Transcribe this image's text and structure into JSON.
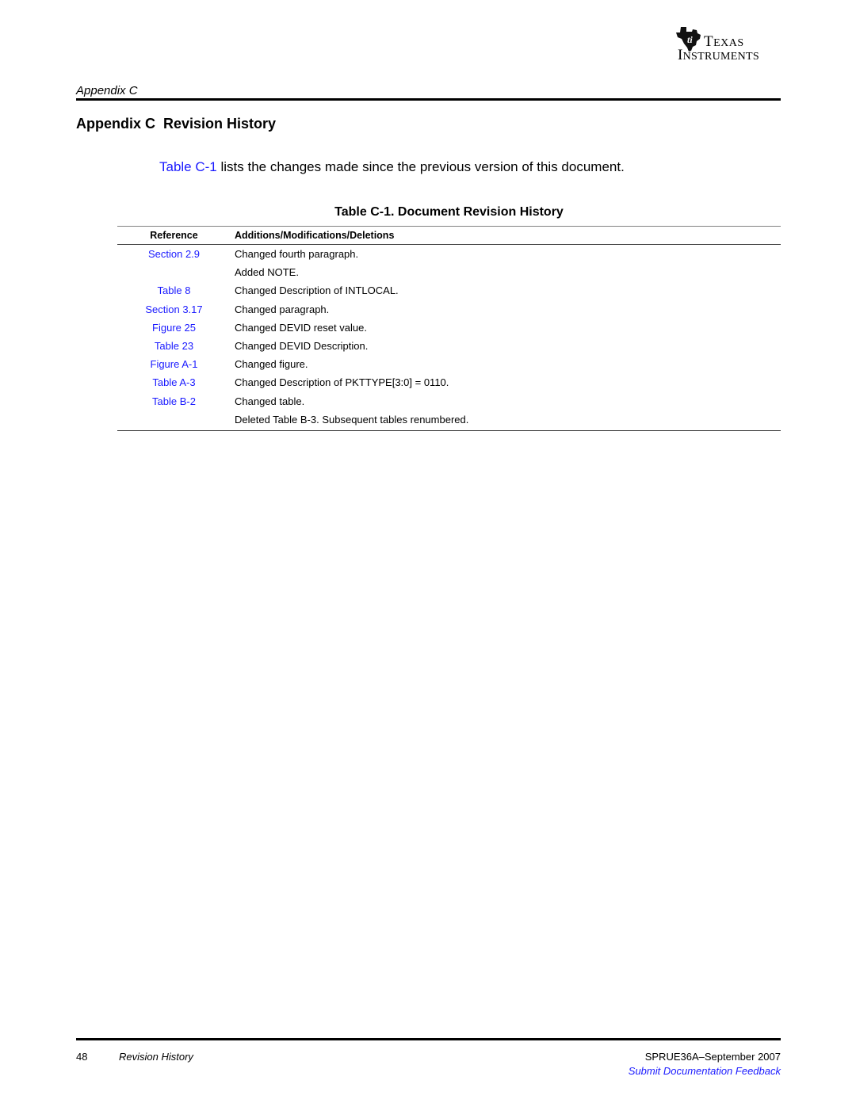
{
  "logo": {
    "line1_initial": "T",
    "line1_rest": "EXAS",
    "line2_initial": "I",
    "line2_rest": "NSTRUMENTS",
    "icon": "ti-state-logo-icon"
  },
  "header": {
    "section_label": "Appendix C"
  },
  "title": "Appendix C  Revision History",
  "intro": {
    "link_text": "Table C-1",
    "text": " lists the changes made since the previous version of this document."
  },
  "table": {
    "caption": "Table C-1. Document Revision History",
    "columns": [
      "Reference",
      "Additions/Modifications/Deletions"
    ],
    "rows": [
      {
        "reference": "Section 2.9",
        "change": "Changed fourth paragraph."
      },
      {
        "reference": "",
        "change": "Added NOTE."
      },
      {
        "reference": "Table 8",
        "change": "Changed Description of INTLOCAL."
      },
      {
        "reference": "Section 3.17",
        "change": "Changed paragraph."
      },
      {
        "reference": "Figure 25",
        "change": "Changed DEVID reset value."
      },
      {
        "reference": "Table 23",
        "change": "Changed DEVID Description."
      },
      {
        "reference": "Figure A-1",
        "change": "Changed figure."
      },
      {
        "reference": "Table A-3",
        "change": "Changed Description of PKTTYPE[3:0] = 0110."
      },
      {
        "reference": "Table B-2",
        "change": "Changed table."
      },
      {
        "reference": "",
        "change": "Deleted Table B-3. Subsequent tables renumbered."
      }
    ]
  },
  "footer": {
    "page_number": "48",
    "section": "Revision History",
    "doc_id": "SPRUE36A–September 2007",
    "feedback_link": "Submit Documentation Feedback"
  },
  "colors": {
    "link": "#1a1aff",
    "text": "#000000"
  }
}
